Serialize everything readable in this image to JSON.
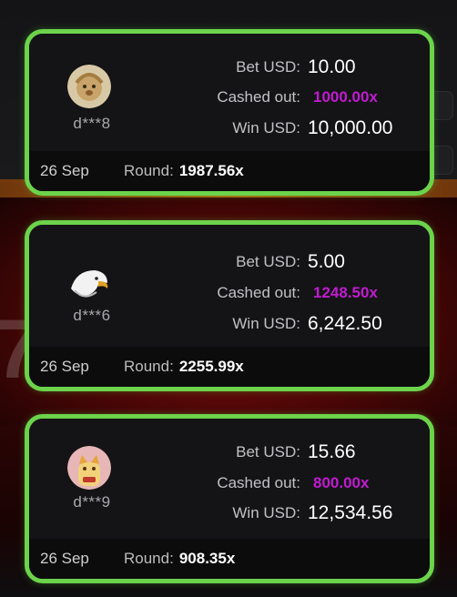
{
  "cards": [
    {
      "user": "d***8",
      "avatar_icon": "lion-avatar-icon",
      "bet_label": "Bet USD:",
      "bet_value": "10.00",
      "cashout_label": "Cashed out:",
      "cashout_value": "1000.00x",
      "win_label": "Win USD:",
      "win_value": "10,000.00",
      "date": "26 Sep",
      "round_label": "Round:",
      "round_value": "1987.56x"
    },
    {
      "user": "d***6",
      "avatar_icon": "eagle-avatar-icon",
      "bet_label": "Bet USD:",
      "bet_value": "5.00",
      "cashout_label": "Cashed out:",
      "cashout_value": "1248.50x",
      "win_label": "Win USD:",
      "win_value": "6,242.50",
      "date": "26 Sep",
      "round_label": "Round:",
      "round_value": "2255.99x"
    },
    {
      "user": "d***9",
      "avatar_icon": "lucky-cat-avatar-icon",
      "bet_label": "Bet USD:",
      "bet_value": "15.66",
      "cashout_label": "Cashed out:",
      "cashout_value": "800.00x",
      "win_label": "Win USD:",
      "win_value": "12,534.56",
      "date": "26 Sep",
      "round_label": "Round:",
      "round_value": "908.35x"
    }
  ],
  "colors": {
    "card_border": "#6cd34b",
    "multiplier": "#c11bd1",
    "card_bg": "#141416"
  }
}
